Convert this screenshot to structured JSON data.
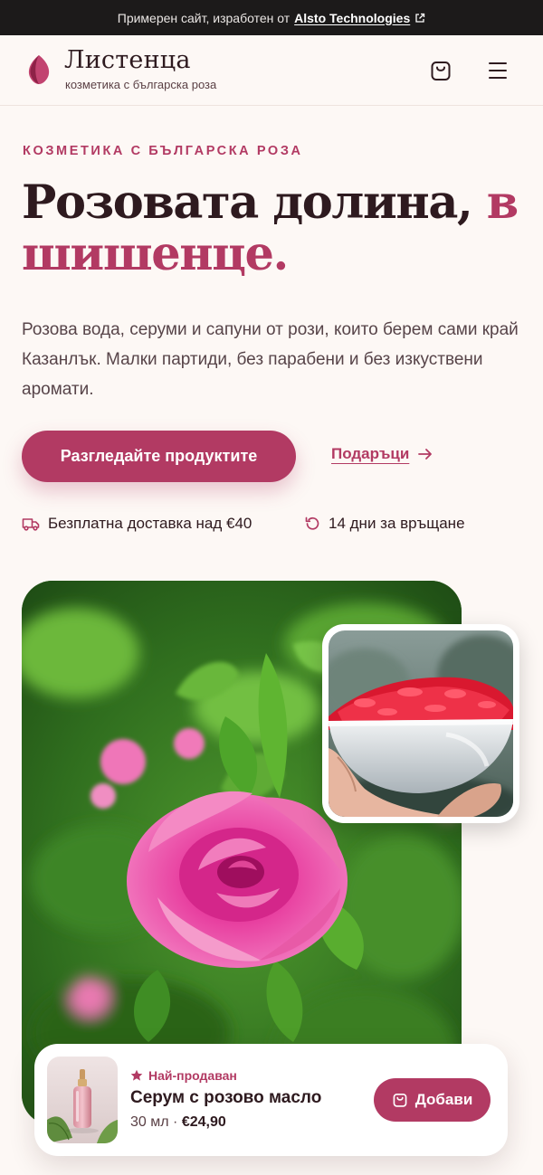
{
  "topbar": {
    "text": "Примерен сайт, изработен от",
    "link_text": "Alsto Technologies",
    "link_icon": "external-link-icon"
  },
  "header": {
    "logo_icon": "rose-petal-logo-icon",
    "brand_name": "Листенца",
    "tagline": "козметика с българска роза",
    "cart_icon": "shopping-bag-icon",
    "menu_icon": "hamburger-menu-icon"
  },
  "hero": {
    "eyebrow": "КОЗМЕТИКА С БЪЛГАРСКА РОЗА",
    "title_main": "Розовата долина,",
    "title_accent": "в шишенце.",
    "subtitle": "Розова вода, серуми и сапуни от рози, които берем сами край Казанлък. Малки партиди, без парабени и без изкуствени аромати.",
    "primary_cta": "Разгледайте продуктите",
    "secondary_cta": "Подаръци",
    "secondary_cta_icon": "arrow-right-icon",
    "perks": [
      {
        "icon": "delivery-truck-icon",
        "label": "Безплатна доставка над €40"
      },
      {
        "icon": "return-arrow-icon",
        "label": "14 дни за връщане"
      }
    ]
  },
  "featured_product": {
    "badge_icon": "star-icon",
    "badge": "Най-продаван",
    "name": "Серум с розово масло",
    "volume": "30 мл",
    "separator": "·",
    "price": "€24,90",
    "add_button": "Добави",
    "add_icon": "shopping-bag-icon"
  },
  "colors": {
    "accent": "#b23a63",
    "text": "#2e1a1f",
    "background": "#fdf8f5",
    "topbar": "#1c1a1a"
  }
}
